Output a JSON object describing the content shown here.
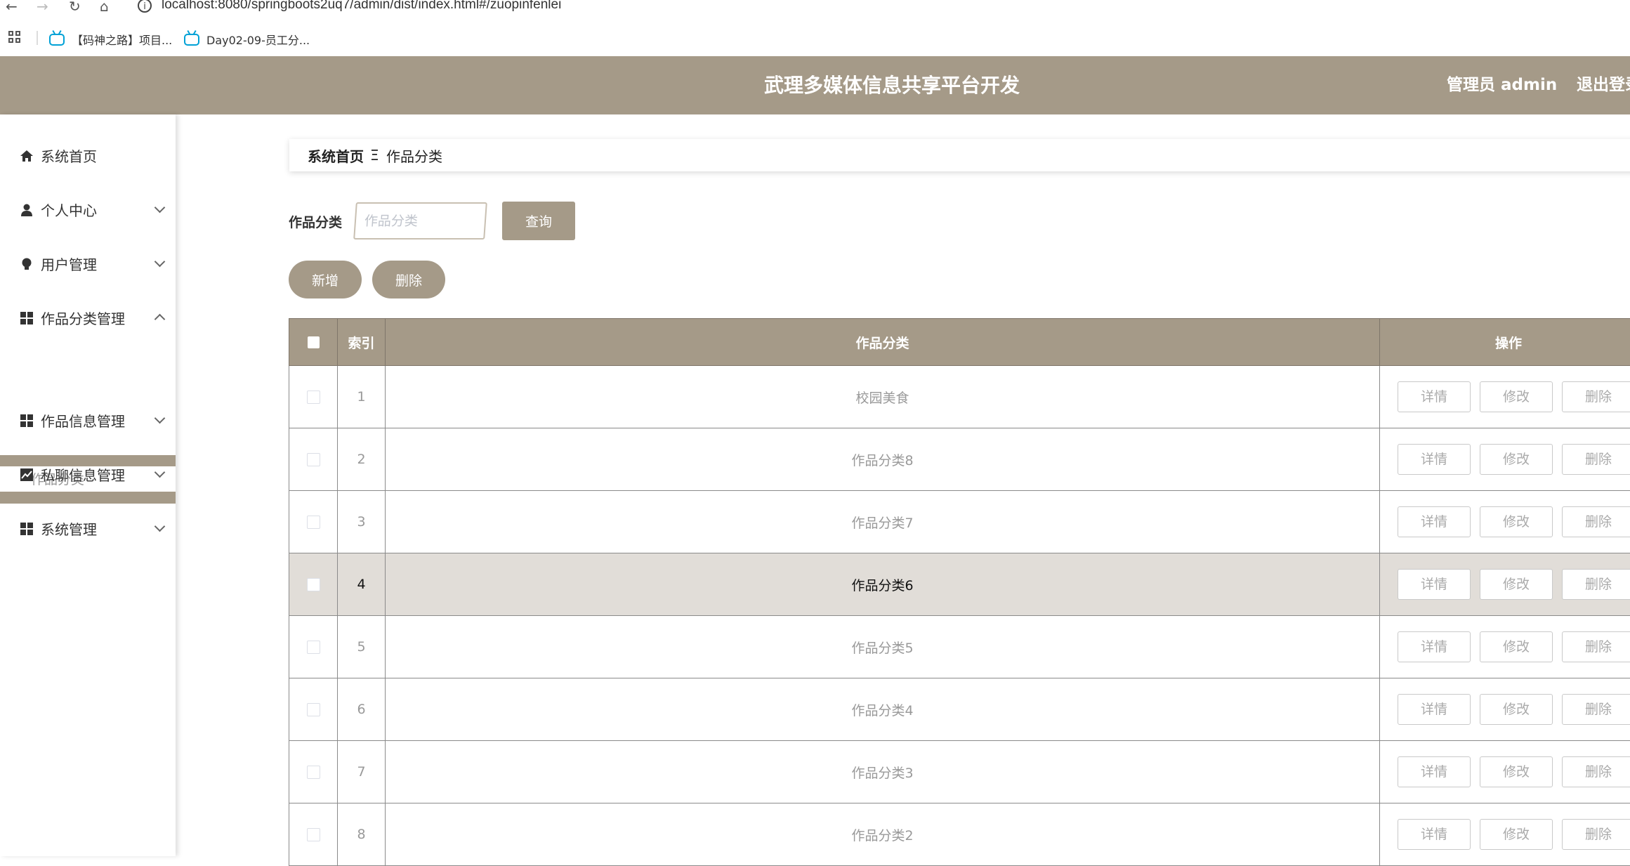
{
  "browser": {
    "url": "localhost:8080/springboots2uq7/admin/dist/index.html#/zuopinfenlei",
    "bookmarks": [
      "【码神之路】项目...",
      "Day02-09-员工分..."
    ]
  },
  "header": {
    "title": "武理多媒体信息共享平台开发",
    "user": "管理员 admin",
    "logout": "退出登录"
  },
  "sidebar": {
    "items": [
      {
        "label": "系统首页",
        "icon": "home-icon"
      },
      {
        "label": "个人中心",
        "icon": "user-icon"
      },
      {
        "label": "用户管理",
        "icon": "bulb-icon"
      },
      {
        "label": "作品分类管理",
        "icon": "grid-icon"
      },
      {
        "label": "作品信息管理",
        "icon": "grid-icon"
      },
      {
        "label": "私聊信息管理",
        "icon": "chart-icon"
      },
      {
        "label": "系统管理",
        "icon": "grid-icon"
      }
    ],
    "sub_item": "作品分类"
  },
  "breadcrumb": {
    "home": "系统首页",
    "separator": "Ξ",
    "current": "作品分类"
  },
  "search": {
    "label": "作品分类",
    "placeholder": "作品分类",
    "query_button": "查询"
  },
  "actions": {
    "add": "新增",
    "delete": "删除"
  },
  "table": {
    "headers": {
      "index": "索引",
      "category": "作品分类",
      "ops": "操作"
    },
    "op_labels": {
      "detail": "详情",
      "edit": "修改",
      "delete": "删除"
    },
    "rows": [
      {
        "index": "1",
        "category": "校园美食"
      },
      {
        "index": "2",
        "category": "作品分类8"
      },
      {
        "index": "3",
        "category": "作品分类7"
      },
      {
        "index": "4",
        "category": "作品分类6"
      },
      {
        "index": "5",
        "category": "作品分类5"
      },
      {
        "index": "6",
        "category": "作品分类4"
      },
      {
        "index": "7",
        "category": "作品分类3"
      },
      {
        "index": "8",
        "category": "作品分类2"
      }
    ]
  },
  "colors": {
    "accent": "#a59a88",
    "highlight_row": "#e1ddd8"
  }
}
